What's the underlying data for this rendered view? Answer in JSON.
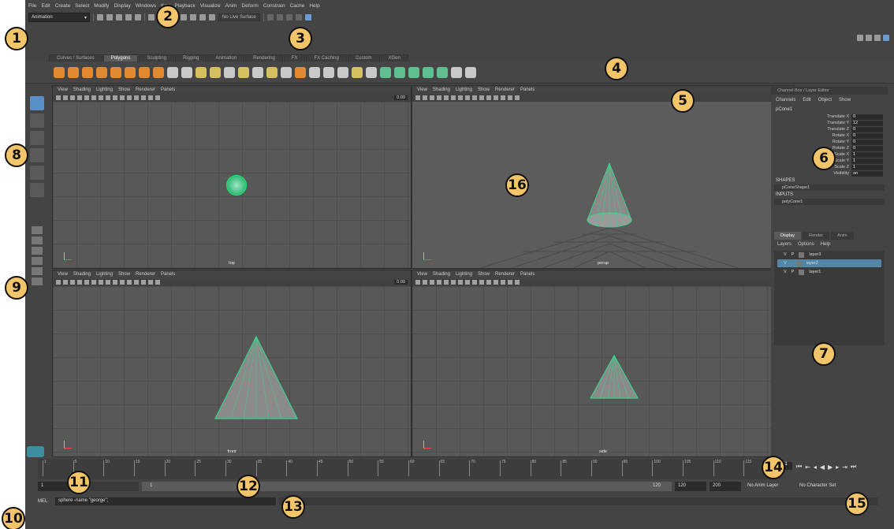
{
  "menubar": [
    "File",
    "Edit",
    "Create",
    "Select",
    "Modify",
    "Display",
    "Windows",
    "Key",
    "Playback",
    "Visualize",
    "Anim",
    "Deform",
    "Constrain",
    "Cache",
    "Help"
  ],
  "statusline": {
    "mode": "Animation",
    "live_surface": "No Live Surface"
  },
  "shelf_tabs": [
    "Curves / Surfaces",
    "Polygons",
    "Sculpting",
    "Rigging",
    "Animation",
    "Rendering",
    "FX",
    "FX Caching",
    "Custom",
    "XGen"
  ],
  "active_shelf_tab": "Polygons",
  "viewport_menu": [
    "View",
    "Shading",
    "Lighting",
    "Show",
    "Renderer",
    "Panels"
  ],
  "viewport_field": "0.00",
  "viewports": [
    {
      "label": "top"
    },
    {
      "label": "persp"
    },
    {
      "label": "front"
    },
    {
      "label": "side"
    }
  ],
  "channel_box": {
    "title": "Channel Box / Layer Editor",
    "menu": [
      "Channels",
      "Edit",
      "Object",
      "Show"
    ],
    "object": "pCone1",
    "attributes": [
      {
        "name": "Translate X",
        "value": "0"
      },
      {
        "name": "Translate Y",
        "value": "12"
      },
      {
        "name": "Translate Z",
        "value": "0"
      },
      {
        "name": "Rotate X",
        "value": "0"
      },
      {
        "name": "Rotate Y",
        "value": "0"
      },
      {
        "name": "Rotate Z",
        "value": "0"
      },
      {
        "name": "Scale X",
        "value": "1"
      },
      {
        "name": "Scale Y",
        "value": "1"
      },
      {
        "name": "Scale Z",
        "value": "1"
      },
      {
        "name": "Visibility",
        "value": "on"
      }
    ],
    "shapes_label": "SHAPES",
    "shape": "pConeShape1",
    "inputs_label": "INPUTS",
    "input": "polyCone1"
  },
  "layer_editor": {
    "tabs": [
      "Display",
      "Render",
      "Anim"
    ],
    "menu": [
      "Layers",
      "Options",
      "Help"
    ],
    "layers": [
      {
        "v": "V",
        "p": "P",
        "name": "layer3",
        "selected": false
      },
      {
        "v": "V",
        "p": "",
        "name": "layer2",
        "selected": true
      },
      {
        "v": "V",
        "p": "P",
        "name": "layer1",
        "selected": false
      }
    ]
  },
  "timeline": {
    "ticks": [
      "1",
      "5",
      "10",
      "15",
      "20",
      "25",
      "30",
      "35",
      "40",
      "45",
      "50",
      "55",
      "60",
      "65",
      "70",
      "75",
      "80",
      "85",
      "90",
      "95",
      "100",
      "105",
      "110",
      "115",
      "120"
    ],
    "current_frame": "1"
  },
  "range": {
    "start": "1",
    "slider_start": "1",
    "slider_end": "120",
    "end": "120",
    "max": "200",
    "anim_layer": "No Anim Layer",
    "char_set": "No Character Set"
  },
  "command": {
    "label": "MEL",
    "text": "sphere -name \"george\";"
  },
  "callouts": [
    "1",
    "2",
    "3",
    "4",
    "5",
    "6",
    "7",
    "8",
    "9",
    "10",
    "11",
    "12",
    "13",
    "14",
    "15",
    "16"
  ],
  "colors": {
    "panel": "#444444",
    "viewport": "#585858",
    "callout": "#f3c56a",
    "mesh": "#3fd189",
    "selection": "#5285a6"
  }
}
